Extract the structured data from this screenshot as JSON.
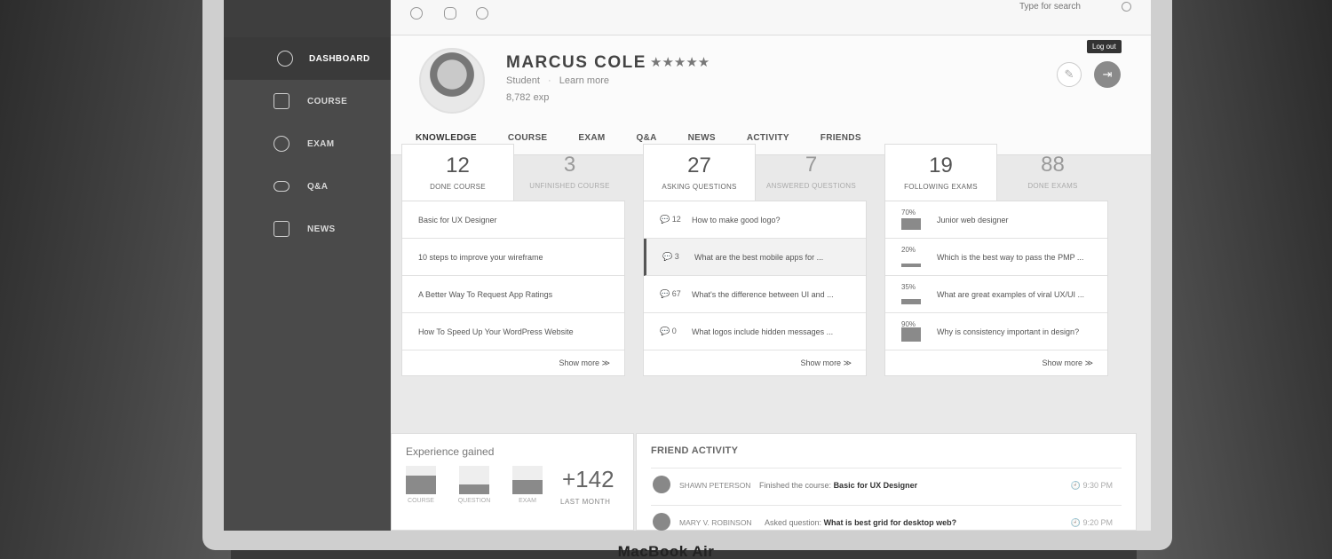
{
  "device": {
    "brand": "MacBook Air"
  },
  "sidebar": {
    "items": [
      {
        "label": "DASHBOARD",
        "icon": "dashboard-icon",
        "active": true
      },
      {
        "label": "COURSE",
        "icon": "course-icon"
      },
      {
        "label": "EXAM",
        "icon": "clock-icon"
      },
      {
        "label": "Q&A",
        "icon": "chat-icon"
      },
      {
        "label": "NEWS",
        "icon": "rss-icon"
      }
    ]
  },
  "topbar": {
    "icons": [
      "user-icon",
      "message-icon",
      "notification-icon"
    ],
    "search_placeholder": "Type for search"
  },
  "profile": {
    "name": "MARCUS COLE",
    "rating": "★★★★★",
    "role": "Student",
    "separator": "·",
    "learn_more": "Learn more",
    "exp": "8,782 exp",
    "logout_tooltip": "Log out",
    "edit_glyph": "✎",
    "logout_glyph": "⇥"
  },
  "tabs": [
    "KNOWLEDGE",
    "COURSE",
    "EXAM",
    "Q&A",
    "NEWS",
    "ACTIVITY",
    "FRIENDS"
  ],
  "courses": {
    "done_count": "12",
    "done_label": "DONE COURSE",
    "unfinished_count": "3",
    "unfinished_label": "UNFINISHED COURSE",
    "items": [
      "Basic for UX Designer",
      "10 steps to improve your wireframe",
      "A Better Way To Request App Ratings",
      "How To Speed Up Your WordPress Website"
    ],
    "show_more": "Show more ≫"
  },
  "questions": {
    "asking_count": "27",
    "asking_label": "ASKING QUESTIONS",
    "answered_count": "7",
    "answered_label": "ANSWERED QUESTIONS",
    "items": [
      {
        "count": "💬 12",
        "text": "How to make good logo?"
      },
      {
        "count": "💬 3",
        "text": "What are the best mobile apps for ..."
      },
      {
        "count": "💬 67",
        "text": "What's the difference between UI and ..."
      },
      {
        "count": "💬 0",
        "text": "What logos include hidden messages ..."
      }
    ],
    "show_more": "Show more ≫"
  },
  "exams": {
    "following_count": "19",
    "following_label": "FOLLOWING EXAMS",
    "done_count": "88",
    "done_label": "DONE EXAMS",
    "items": [
      {
        "pct": "70%",
        "value": 70,
        "text": "Junior web designer"
      },
      {
        "pct": "20%",
        "value": 20,
        "text": "Which is the best way to pass the PMP ..."
      },
      {
        "pct": "35%",
        "value": 35,
        "text": "What are great examples of viral UX/UI ..."
      },
      {
        "pct": "90%",
        "value": 90,
        "text": "Why is consistency important in design?"
      }
    ],
    "show_more": "Show more ≫"
  },
  "experience": {
    "title": "Experience gained",
    "bars": [
      {
        "label": "COURSE",
        "value": 65
      },
      {
        "label": "QUESTION",
        "value": 35
      },
      {
        "label": "EXAM",
        "value": 50
      }
    ],
    "total": "+142",
    "total_label": "LAST MONTH"
  },
  "friend_activity": {
    "title": "FRIEND ACTIVITY",
    "items": [
      {
        "name": "SHAWN PETERSON",
        "action": "Finished the course:",
        "item": "Basic for UX Designer",
        "time": "🕘 9:30 PM"
      },
      {
        "name": "MARY V. ROBINSON",
        "action": "Asked question:",
        "item": "What is best grid for desktop web?",
        "time": "🕘 9:20 PM"
      }
    ]
  }
}
